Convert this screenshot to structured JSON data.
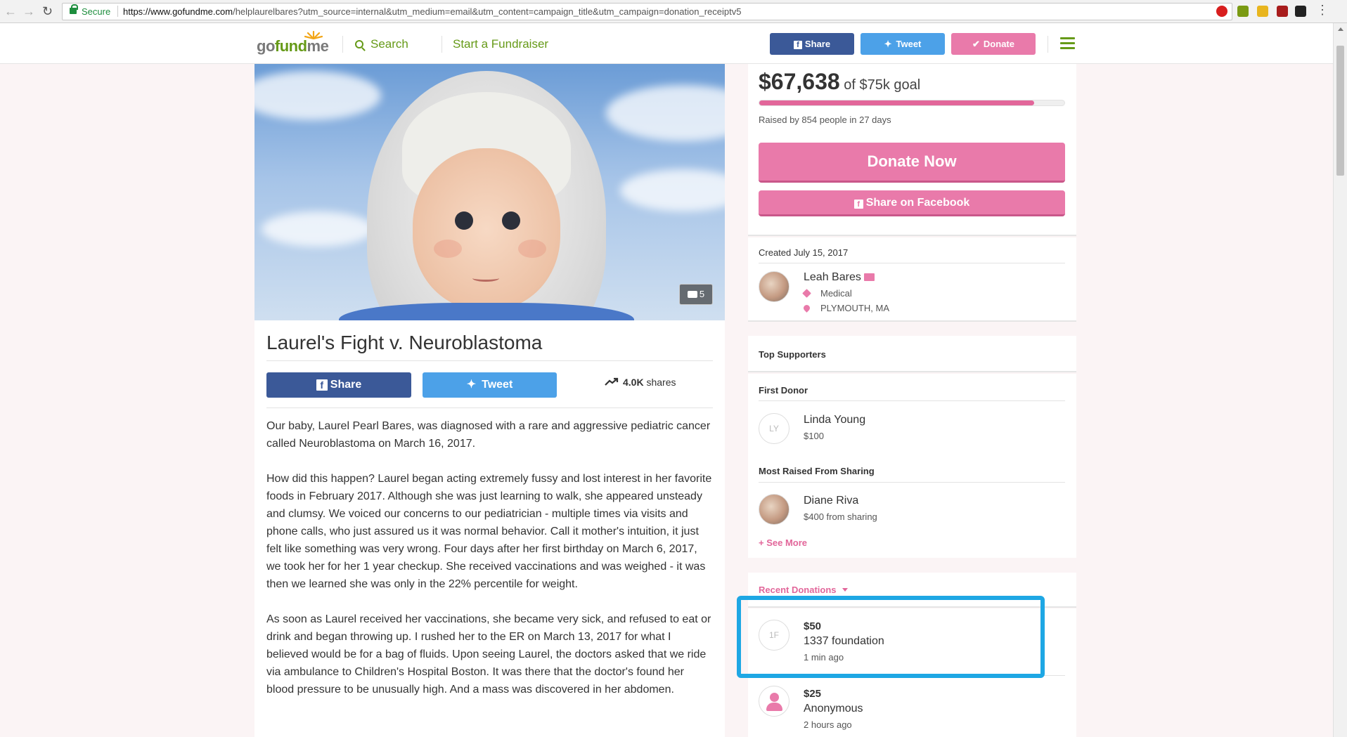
{
  "browser": {
    "secure_label": "Secure",
    "url_host": "https://www.gofundme.com",
    "url_path": "/helplaurelbares?utm_source=internal&utm_medium=email&utm_content=campaign_title&utm_campaign=donation_receiptv5"
  },
  "header": {
    "logo_go": "go",
    "logo_fund": "fund",
    "logo_me": "me",
    "search_label": "Search",
    "start_label": "Start a Fundraiser",
    "share_label": "Share",
    "tweet_label": "Tweet",
    "donate_label": "Donate"
  },
  "campaign": {
    "photo_count": "5",
    "title": "Laurel's Fight v. Neuroblastoma",
    "share_label": "Share",
    "tweet_label": "Tweet",
    "shares_count": "4.0K",
    "shares_suffix": " shares",
    "story": [
      "Our baby, Laurel Pearl Bares, was diagnosed with a rare and aggressive pediatric cancer called Neuroblastoma on March 16, 2017.",
      "How did this happen? Laurel began acting extremely fussy and lost interest in her favorite foods in February 2017. Although she was just learning to walk, she appeared unsteady and clumsy.  We voiced our concerns to our pediatrician - multiple times via visits and phone calls, who just assured us it was normal behavior. Call it mother's intuition, it just felt like something was very wrong. Four days after her first birthday on March 6, 2017, we took her for her 1 year checkup. She received vaccinations and was weighed - it was then we learned she was only in the 22% percentile for weight.",
      "As soon as Laurel received her vaccinations, she became very sick, and refused to eat or drink and began throwing up. I rushed her to the ER on March 13, 2017 for what I believed would be for a bag of fluids. Upon seeing Laurel, the doctors asked that we ride via ambulance to Children's Hospital Boston. It was there that the doctor's found her blood pressure to be unusually high. And a mass was discovered in her abdomen."
    ]
  },
  "funding": {
    "raised": "$67,638",
    "goal_text": " of $75k goal",
    "progress_fraction": 0.9,
    "raised_by": "Raised by 854 people in 27 days",
    "donate_now": "Donate Now",
    "share_facebook": "Share on Facebook"
  },
  "organizer": {
    "created": "Created July 15, 2017",
    "name": "Leah Bares",
    "category": "Medical",
    "location": "PLYMOUTH, MA"
  },
  "supporters": {
    "heading": "Top Supporters",
    "first_donor_heading": "First Donor",
    "first_donor_initials": "LY",
    "first_donor_name": "Linda Young",
    "first_donor_amount": "$100",
    "sharing_heading": "Most Raised From Sharing",
    "sharing_name": "Diane Riva",
    "sharing_amount": "$400 from sharing",
    "see_more": "See More"
  },
  "recent": {
    "heading": "Recent Donations",
    "items": [
      {
        "initials": "1F",
        "amount": "$50",
        "name": "1337 foundation",
        "time": "1 min ago"
      },
      {
        "amount": "$25",
        "name": "Anonymous",
        "time": "2 hours ago"
      }
    ]
  },
  "colors": {
    "brand_green": "#669a18",
    "pink": "#e97aaa",
    "facebook": "#3b5998",
    "twitter": "#4ca1e8",
    "highlight": "#1ea7e4"
  },
  "icons": [
    "back-icon",
    "forward-icon",
    "reload-icon",
    "lock-icon",
    "star-icon",
    "search-icon",
    "facebook-icon",
    "twitter-icon",
    "check-icon",
    "menu-icon",
    "camera-icon",
    "trending-icon",
    "envelope-icon",
    "tag-icon",
    "pin-icon",
    "plus-icon",
    "caret-down-icon",
    "anonymous-user-icon"
  ]
}
